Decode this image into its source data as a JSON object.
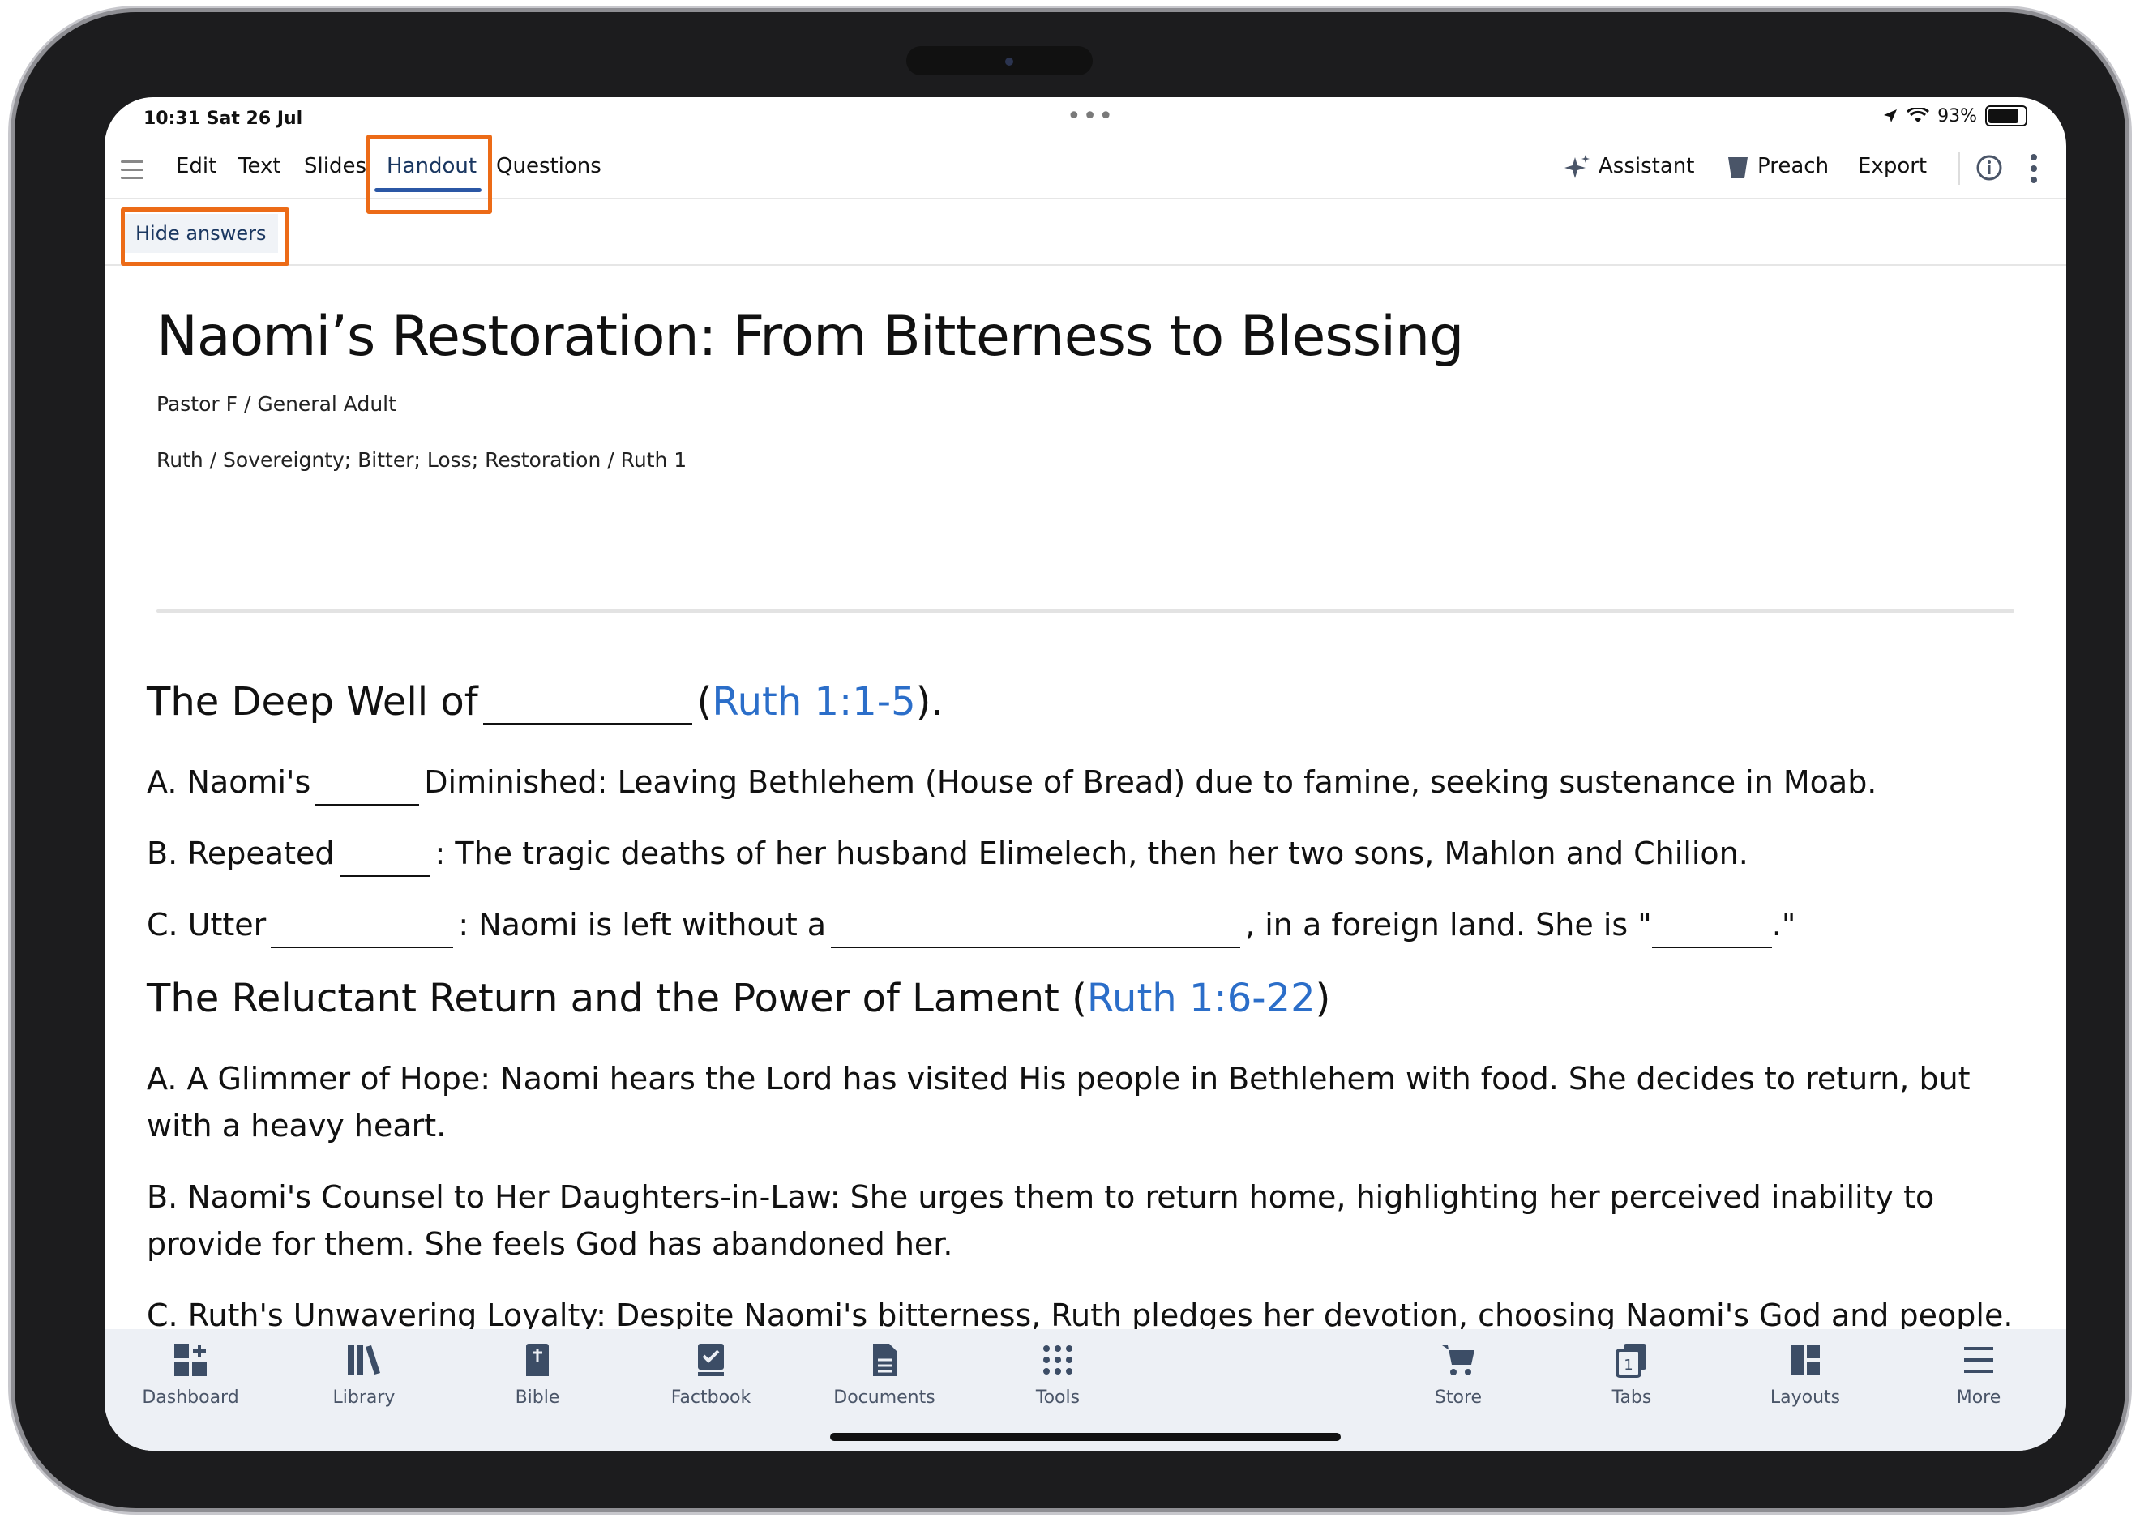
{
  "status_bar": {
    "time": "10:31  Sat 26 Jul",
    "battery": "93%",
    "battery_level": 0.93,
    "multitask": "•••"
  },
  "toolbar": {
    "tabs": [
      "Edit",
      "Text",
      "Slides",
      "Handout",
      "Questions"
    ],
    "active_tab": "Handout",
    "assistant": "Assistant",
    "preach": "Preach",
    "export": "Export"
  },
  "hide_answers": "Hide answers",
  "document": {
    "title": "Naomi’s Restoration: From Bitterness to Blessing",
    "author_line": "Pastor F / General Adult",
    "topics_line": "Ruth / Sovereignty; Bitter; Loss; Restoration / Ruth 1",
    "section1": {
      "heading_pre": "The Deep Well of",
      "heading_ref": "Ruth 1:1-5",
      "a_pre": "A. Naomi's",
      "a_post": "Diminished: Leaving Bethlehem (House of Bread) due to famine, seeking sustenance in Moab.",
      "b_pre": "B. Repeated",
      "b_post": ": The tragic deaths of her husband Elimelech, then her two sons, Mahlon and Chilion.",
      "c_pre": "C. Utter",
      "c_mid": ": Naomi is left without a",
      "c_post": ", in a foreign land. She is \"",
      "c_end": ".\""
    },
    "section2": {
      "heading_pre": "The Reluctant Return and the Power of Lament (",
      "heading_ref": "Ruth 1:6-22",
      "heading_post": ")",
      "a": "A. A Glimmer of Hope: Naomi hears the Lord has visited His people in Bethlehem with food. She decides to return, but with a heavy heart.",
      "b": "B. Naomi's Counsel to Her Daughters-in-Law: She urges them to return home, highlighting her perceived inability to provide for them. She feels God has abandoned her.",
      "c": "C. Ruth's Unwavering Loyalty: Despite Naomi's bitterness, Ruth pledges her devotion, choosing Naomi's God and people. This is a crucial, undeserved act of faithfulness towards Naomi."
    }
  },
  "tabbar": [
    "Dashboard",
    "Library",
    "Bible",
    "Factbook",
    "Documents",
    "Tools",
    "Store",
    "Tabs",
    "Layouts",
    "More"
  ],
  "colors": {
    "accent": "#2b57a5",
    "link": "#2b6ec9",
    "highlight": "#ec6b17"
  }
}
